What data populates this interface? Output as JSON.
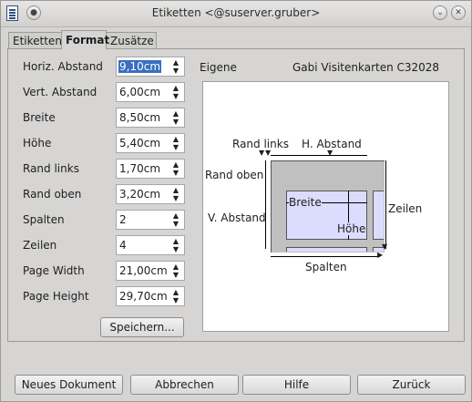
{
  "window": {
    "title": "Etiketten <@suserver.gruber>"
  },
  "tabs": [
    {
      "label": "Etiketten"
    },
    {
      "label": "Format"
    },
    {
      "label": "Zusätze"
    }
  ],
  "fields": [
    {
      "label": "Horiz. Abstand",
      "value": "9,10cm"
    },
    {
      "label": "Vert. Abstand",
      "value": "6,00cm"
    },
    {
      "label": "Breite",
      "value": "8,50cm"
    },
    {
      "label": "Höhe",
      "value": "5,40cm"
    },
    {
      "label": "Rand links",
      "value": "1,70cm"
    },
    {
      "label": "Rand oben",
      "value": "3,20cm"
    },
    {
      "label": "Spalten",
      "value": "2"
    },
    {
      "label": "Zeilen",
      "value": "4"
    },
    {
      "label": "Page Width",
      "value": "21,00cm"
    },
    {
      "label": "Page Height",
      "value": "29,70cm"
    }
  ],
  "save_button": "Speichern...",
  "label_type": {
    "left": "Eigene",
    "right": "Gabi Visitenkarten C32028"
  },
  "preview": {
    "rand_links": "Rand links",
    "h_abstand": "H. Abstand",
    "rand_oben": "Rand oben",
    "v_abstand": "V. Abstand",
    "breite": "Breite",
    "hoehe": "Höhe",
    "zeilen": "Zeilen",
    "spalten": "Spalten"
  },
  "footer": {
    "new_document": "Neues Dokument",
    "cancel": "Abbrechen",
    "help": "Hilfe",
    "back": "Zurück"
  },
  "colors": {
    "selection": "#3a6fbf",
    "label_fill": "#dcdcff",
    "page_gray": "#c0c0c0"
  }
}
